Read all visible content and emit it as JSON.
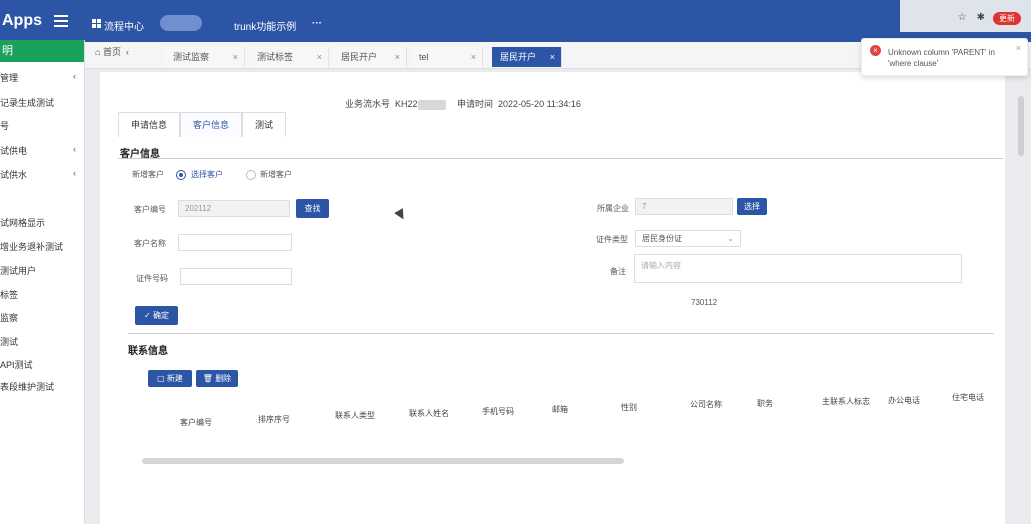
{
  "app": {
    "title": "Apps"
  },
  "topnav": {
    "item1": "流程中心",
    "item2": "trunk功能示例",
    "more": "···"
  },
  "browser": {
    "update_label": "更新"
  },
  "sidebar": {
    "header": "明",
    "items": [
      {
        "label": "管理",
        "has_chevron": true
      },
      {
        "label": "记录生成测试",
        "has_chevron": false
      },
      {
        "label": "号",
        "has_chevron": false
      },
      {
        "label": "试供电",
        "has_chevron": true
      },
      {
        "label": "试供水",
        "has_chevron": true
      },
      {
        "label": "试网格显示",
        "has_chevron": false
      },
      {
        "label": "增业务退补测试",
        "has_chevron": false
      },
      {
        "label": "测试用户",
        "has_chevron": false
      },
      {
        "label": "标签",
        "has_chevron": false
      },
      {
        "label": "监察",
        "has_chevron": false
      },
      {
        "label": "测试",
        "has_chevron": false
      },
      {
        "label": "API测试",
        "has_chevron": false
      },
      {
        "label": "表段维护测试",
        "has_chevron": false
      }
    ]
  },
  "tabs": {
    "home": "首页",
    "list": [
      {
        "label": "测试监察",
        "active": false
      },
      {
        "label": "测试标签",
        "active": false
      },
      {
        "label": "居民开户",
        "active": false
      },
      {
        "label": "tel",
        "active": false
      },
      {
        "label": "居民开户",
        "active": true
      }
    ]
  },
  "toast": {
    "message": "Unknown column 'PARENT' in 'where clause'",
    "close": "×"
  },
  "form": {
    "serial_label": "业务流水号",
    "serial_value": "KH22",
    "apply_time_label": "申请时间",
    "apply_time_value": "2022-05-20 11:34:16",
    "inner_tabs": [
      "申请信息",
      "客户信息",
      "测试"
    ],
    "customer_section": "客户信息",
    "add_customer_label": "新增客户",
    "radio_select": "选择客户",
    "radio_new": "新增客户",
    "customer_no_label": "客户编号",
    "customer_no_value": "202112",
    "search_button": "查找",
    "company_label": "所属企业",
    "company_value": "7",
    "select_button": "选择",
    "customer_name_label": "客户名称",
    "id_type_label": "证件类型",
    "id_type_value": "居民身份证",
    "id_no_label": "证件号码",
    "remark_label": "备注",
    "remark_placeholder": "请输入内容",
    "remark_hint": "730112",
    "confirm_button": "确定"
  },
  "contact": {
    "section": "联系信息",
    "new_button": "新建",
    "delete_button": "删除",
    "columns": [
      "客户编号",
      "排序序号",
      "联系人类型",
      "联系人姓名",
      "手机号码",
      "邮箱",
      "性别",
      "公司名称",
      "职务",
      "主联系人标志",
      "办公电话",
      "住宅电话"
    ]
  },
  "colors": {
    "accent": "#2d55a6",
    "sidebar_active": "#1aa15b",
    "error": "#e04444"
  }
}
